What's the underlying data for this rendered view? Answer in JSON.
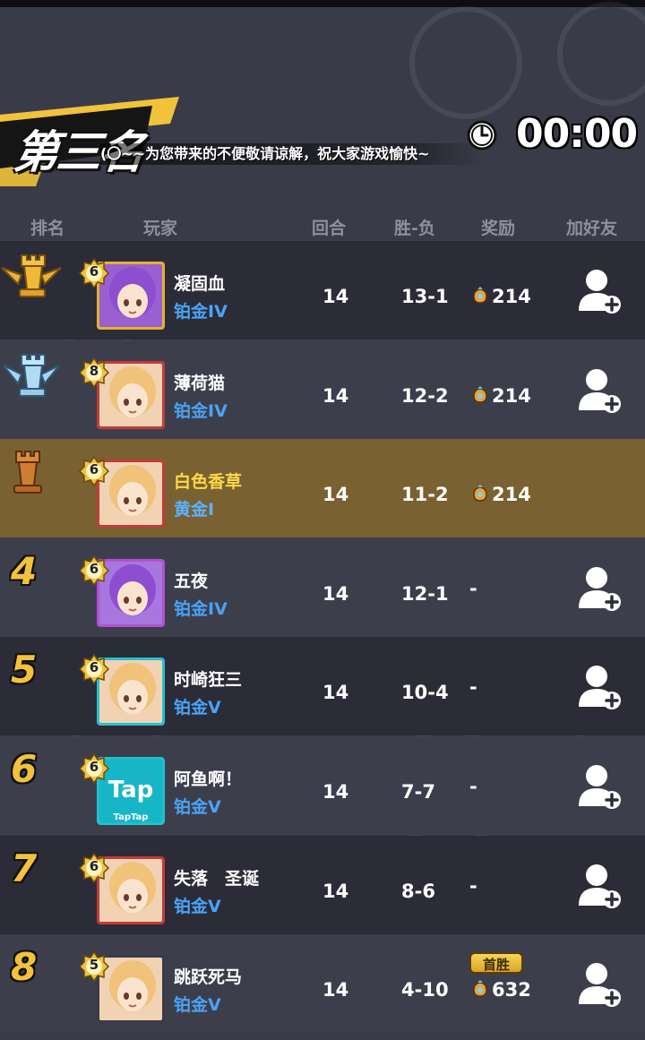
{
  "header": {
    "placement_title": "第三名",
    "notice": "(〇~~为您带来的不便敬请谅解，祝大家游戏愉快~",
    "timer": "00:00"
  },
  "columns": [
    "排名",
    "玩家",
    "回合",
    "胜-负",
    "奖励",
    "加好友"
  ],
  "rows": [
    {
      "rank": "1",
      "rank_icon": "gold-crown-rook",
      "level": "6",
      "name": "凝固血",
      "tier": "铂金IV",
      "rounds": "14",
      "win_loss": "13-1",
      "reward": "214",
      "first_win": "",
      "avatar": "purple-hair-girl-gold-frame",
      "self": false
    },
    {
      "rank": "2",
      "rank_icon": "silver-winged-rook",
      "level": "8",
      "name": "薄荷猫",
      "tier": "铂金IV",
      "rounds": "14",
      "win_loss": "12-2",
      "reward": "214",
      "first_win": "",
      "avatar": "blonde-girl-red-frame",
      "self": false
    },
    {
      "rank": "3",
      "rank_icon": "bronze-rook",
      "level": "6",
      "name": "白色香草",
      "tier": "黄金I",
      "rounds": "14",
      "win_loss": "11-2",
      "reward": "214",
      "first_win": "",
      "avatar": "blonde-girl-red-frame",
      "self": true
    },
    {
      "rank": "4",
      "rank_icon": "",
      "level": "6",
      "name": "五夜",
      "tier": "铂金IV",
      "rounds": "14",
      "win_loss": "12-1",
      "reward": "-",
      "first_win": "",
      "avatar": "purple-hair-girl-pink-frame",
      "self": false
    },
    {
      "rank": "5",
      "rank_icon": "",
      "level": "6",
      "name": "时崎狂三",
      "tier": "铂金V",
      "rounds": "14",
      "win_loss": "10-4",
      "reward": "-",
      "first_win": "",
      "avatar": "blonde-girl-taptap-frame",
      "self": false
    },
    {
      "rank": "6",
      "rank_icon": "",
      "level": "6",
      "name": "阿鱼啊！",
      "tier": "铂金V",
      "rounds": "14",
      "win_loss": "7-7",
      "reward": "-",
      "first_win": "",
      "avatar": "taptap-logo",
      "self": false
    },
    {
      "rank": "7",
      "rank_icon": "",
      "level": "6",
      "name": "失落　圣诞",
      "tier": "铂金V",
      "rounds": "14",
      "win_loss": "8-6",
      "reward": "-",
      "first_win": "",
      "avatar": "blonde-girl-red-frame",
      "self": false
    },
    {
      "rank": "8",
      "rank_icon": "",
      "level": "5",
      "name": "跳跃死马",
      "tier": "铂金V",
      "rounds": "14",
      "win_loss": "4-10",
      "reward": "632",
      "first_win": "首胜",
      "avatar": "blonde-girl-plain-frame",
      "self": false
    }
  ],
  "colors": {
    "rank_number": "#f2c23b",
    "tier_text": "#4aa3f5",
    "self_row": "#7a6132",
    "self_name": "#ffd84a"
  }
}
